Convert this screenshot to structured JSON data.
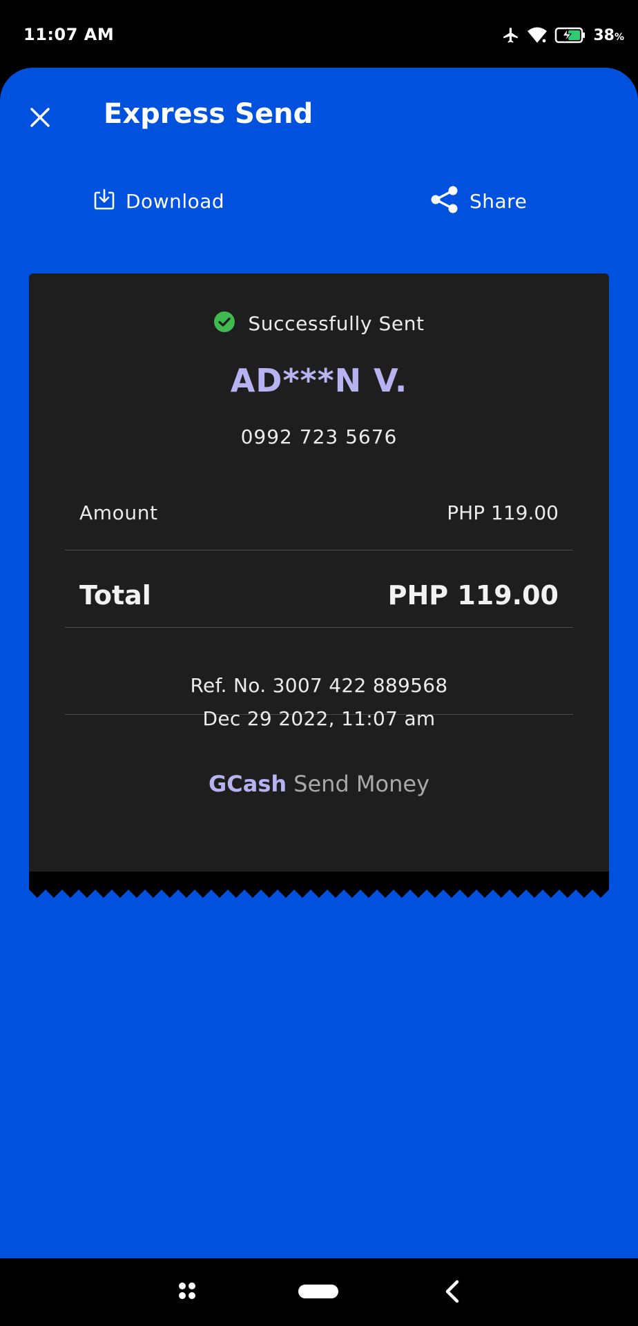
{
  "status_bar": {
    "time": "11:07 AM",
    "battery_percent": "38",
    "battery_unit": "%",
    "icons": [
      "airplane-icon",
      "wifi-icon",
      "battery-charging-icon"
    ]
  },
  "header": {
    "title": "Express Send",
    "close_icon": "close-icon"
  },
  "actions": {
    "download_label": "Download",
    "download_icon": "download-icon",
    "share_label": "Share",
    "share_icon": "share-icon"
  },
  "receipt": {
    "status_text": "Successfully Sent",
    "status_icon": "check-circle-icon",
    "recipient_name": "AD***N V.",
    "recipient_number": "0992 723 5676",
    "amount_label": "Amount",
    "amount_value": "PHP 119.00",
    "total_label": "Total",
    "total_value": "PHP 119.00",
    "reference": "Ref. No. 3007 422 889568",
    "datetime": "Dec 29 2022, 11:07 am",
    "brand": "GCash",
    "service": "Send Money"
  },
  "colors": {
    "background_blue": "#0052DE",
    "receipt_dark": "#1E1E1E",
    "accent_lavender": "#B7B2F0",
    "success_green": "#3FB950"
  },
  "nav_bar": {
    "icons": [
      "recents-icon",
      "home-pill-icon",
      "back-icon"
    ]
  }
}
